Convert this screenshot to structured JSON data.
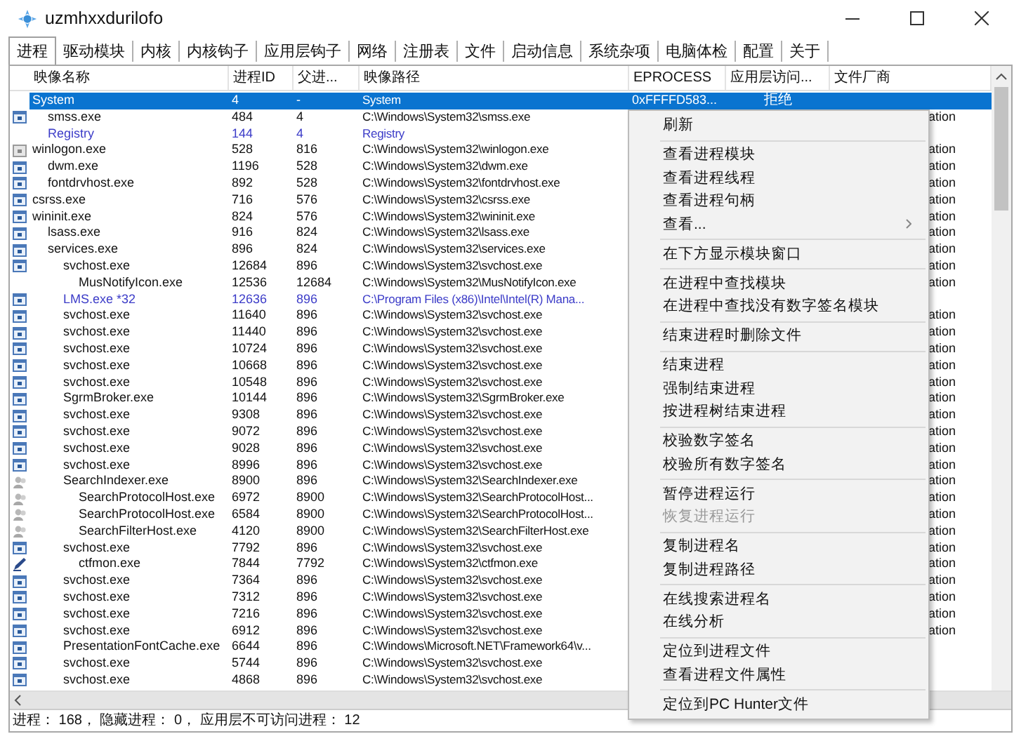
{
  "window": {
    "title": "uzmhxxdurilofo"
  },
  "tabs": [
    {
      "label": "进程",
      "selected": true
    },
    {
      "label": "驱动模块",
      "selected": false
    },
    {
      "label": "内核",
      "selected": false
    },
    {
      "label": "内核钩子",
      "selected": false
    },
    {
      "label": "应用层钩子",
      "selected": false
    },
    {
      "label": "网络",
      "selected": false
    },
    {
      "label": "注册表",
      "selected": false
    },
    {
      "label": "文件",
      "selected": false
    },
    {
      "label": "启动信息",
      "selected": false
    },
    {
      "label": "系统杂项",
      "selected": false
    },
    {
      "label": "电脑体检",
      "selected": false
    },
    {
      "label": "配置",
      "selected": false
    },
    {
      "label": "关于",
      "selected": false
    }
  ],
  "table": {
    "columns": [
      "映像名称",
      "进程ID",
      "父进...",
      "映像路径",
      "EPROCESS",
      "应用层访问...",
      "文件厂商"
    ],
    "rows": [
      {
        "kind": "none",
        "name": "System",
        "pid": "4",
        "parent": "-",
        "path": "System",
        "eprocess": "0xFFFFD583...",
        "access": "拒绝",
        "selected": true,
        "children": [
          {
            "kind": "window",
            "name": "smss.exe",
            "pid": "484",
            "parent": "4",
            "path": "C:\\Windows\\System32\\smss.exe",
            "vendor": "ation",
            "selected": false
          },
          {
            "kind": "none",
            "name": "Registry",
            "pid": "144",
            "parent": "4",
            "path": "Registry",
            "color": "#3c3cc8",
            "selected": false
          }
        ]
      },
      {
        "kind": "gray",
        "name": "winlogon.exe",
        "pid": "528",
        "parent": "816",
        "path": "C:\\Windows\\System32\\winlogon.exe",
        "vendor": "ation",
        "selected": false,
        "children": [
          {
            "kind": "window",
            "name": "dwm.exe",
            "pid": "1196",
            "parent": "528",
            "path": "C:\\Windows\\System32\\dwm.exe",
            "vendor": "ation",
            "selected": false
          },
          {
            "kind": "window",
            "name": "fontdrvhost.exe",
            "pid": "892",
            "parent": "528",
            "path": "C:\\Windows\\System32\\fontdrvhost.exe",
            "vendor": "ation",
            "selected": false
          }
        ]
      },
      {
        "kind": "window",
        "name": "csrss.exe",
        "pid": "716",
        "parent": "576",
        "path": "C:\\Windows\\System32\\csrss.exe",
        "vendor": "ation",
        "selected": false
      },
      {
        "kind": "window",
        "name": "wininit.exe",
        "pid": "824",
        "parent": "576",
        "path": "C:\\Windows\\System32\\wininit.exe",
        "vendor": "ation",
        "selected": false,
        "children": [
          {
            "kind": "window",
            "name": "lsass.exe",
            "pid": "916",
            "parent": "824",
            "path": "C:\\Windows\\System32\\lsass.exe",
            "vendor": "ation",
            "selected": false
          },
          {
            "kind": "window",
            "name": "services.exe",
            "pid": "896",
            "parent": "824",
            "path": "C:\\Windows\\System32\\services.exe",
            "vendor": "ation",
            "selected": false,
            "children": [
              {
                "kind": "window",
                "name": "svchost.exe",
                "pid": "12684",
                "parent": "896",
                "path": "C:\\Windows\\System32\\svchost.exe",
                "vendor": "ation",
                "selected": false,
                "children": [
                  {
                    "kind": "none",
                    "name": "MusNotifyIcon.exe",
                    "pid": "12536",
                    "parent": "12684",
                    "path": "C:\\Windows\\System32\\MusNotifyIcon.exe",
                    "vendor": "ation",
                    "selected": false
                  }
                ]
              },
              {
                "kind": "window",
                "name": "LMS.exe *32",
                "pid": "12636",
                "parent": "896",
                "path": "C:\\Program Files (x86)\\Intel\\Intel(R) Mana...",
                "color": "#3c3cc8",
                "selected": false
              },
              {
                "kind": "window",
                "name": "svchost.exe",
                "pid": "11640",
                "parent": "896",
                "path": "C:\\Windows\\System32\\svchost.exe",
                "vendor": "ation",
                "selected": false
              },
              {
                "kind": "window",
                "name": "svchost.exe",
                "pid": "11440",
                "parent": "896",
                "path": "C:\\Windows\\System32\\svchost.exe",
                "vendor": "ation",
                "selected": false
              },
              {
                "kind": "window",
                "name": "svchost.exe",
                "pid": "10724",
                "parent": "896",
                "path": "C:\\Windows\\System32\\svchost.exe",
                "vendor": "ation",
                "selected": false
              },
              {
                "kind": "window",
                "name": "svchost.exe",
                "pid": "10668",
                "parent": "896",
                "path": "C:\\Windows\\System32\\svchost.exe",
                "vendor": "ation",
                "selected": false
              },
              {
                "kind": "window",
                "name": "svchost.exe",
                "pid": "10548",
                "parent": "896",
                "path": "C:\\Windows\\System32\\svchost.exe",
                "vendor": "ation",
                "selected": false
              },
              {
                "kind": "window",
                "name": "SgrmBroker.exe",
                "pid": "10144",
                "parent": "896",
                "path": "C:\\Windows\\System32\\SgrmBroker.exe",
                "vendor": "ation",
                "selected": false
              },
              {
                "kind": "window",
                "name": "svchost.exe",
                "pid": "9308",
                "parent": "896",
                "path": "C:\\Windows\\System32\\svchost.exe",
                "vendor": "ation",
                "selected": false
              },
              {
                "kind": "window",
                "name": "svchost.exe",
                "pid": "9072",
                "parent": "896",
                "path": "C:\\Windows\\System32\\svchost.exe",
                "vendor": "ation",
                "selected": false
              },
              {
                "kind": "window",
                "name": "svchost.exe",
                "pid": "9028",
                "parent": "896",
                "path": "C:\\Windows\\System32\\svchost.exe",
                "vendor": "ation",
                "selected": false
              },
              {
                "kind": "window",
                "name": "svchost.exe",
                "pid": "8996",
                "parent": "896",
                "path": "C:\\Windows\\System32\\svchost.exe",
                "vendor": "ation",
                "selected": false
              },
              {
                "kind": "search",
                "name": "SearchIndexer.exe",
                "pid": "8900",
                "parent": "896",
                "path": "C:\\Windows\\System32\\SearchIndexer.exe",
                "vendor": "ation",
                "selected": false,
                "children": [
                  {
                    "kind": "search",
                    "name": "SearchProtocolHost.exe",
                    "pid": "6972",
                    "parent": "8900",
                    "path": "C:\\Windows\\System32\\SearchProtocolHost...",
                    "vendor": "ation",
                    "selected": false
                  },
                  {
                    "kind": "search",
                    "name": "SearchProtocolHost.exe",
                    "pid": "6584",
                    "parent": "8900",
                    "path": "C:\\Windows\\System32\\SearchProtocolHost...",
                    "vendor": "ation",
                    "selected": false
                  },
                  {
                    "kind": "search",
                    "name": "SearchFilterHost.exe",
                    "pid": "4120",
                    "parent": "8900",
                    "path": "C:\\Windows\\System32\\SearchFilterHost.exe",
                    "vendor": "ation",
                    "selected": false
                  }
                ]
              },
              {
                "kind": "window",
                "name": "svchost.exe",
                "pid": "7792",
                "parent": "896",
                "path": "C:\\Windows\\System32\\svchost.exe",
                "vendor": "ation",
                "selected": false,
                "children": [
                  {
                    "kind": "pen",
                    "name": "ctfmon.exe",
                    "pid": "7844",
                    "parent": "7792",
                    "path": "C:\\Windows\\System32\\ctfmon.exe",
                    "vendor": "ation",
                    "selected": false
                  }
                ]
              },
              {
                "kind": "window",
                "name": "svchost.exe",
                "pid": "7364",
                "parent": "896",
                "path": "C:\\Windows\\System32\\svchost.exe",
                "vendor": "ation",
                "selected": false
              },
              {
                "kind": "window",
                "name": "svchost.exe",
                "pid": "7312",
                "parent": "896",
                "path": "C:\\Windows\\System32\\svchost.exe",
                "vendor": "ation",
                "selected": false
              },
              {
                "kind": "window",
                "name": "svchost.exe",
                "pid": "7216",
                "parent": "896",
                "path": "C:\\Windows\\System32\\svchost.exe",
                "vendor": "ation",
                "selected": false
              },
              {
                "kind": "window",
                "name": "svchost.exe",
                "pid": "6912",
                "parent": "896",
                "path": "C:\\Windows\\System32\\svchost.exe",
                "vendor": "ation",
                "selected": false
              },
              {
                "kind": "window",
                "name": "PresentationFontCache.exe",
                "pid": "6644",
                "parent": "896",
                "path": "C:\\Windows\\Microsoft.NET\\Framework64\\v...",
                "selected": false
              },
              {
                "kind": "window",
                "name": "svchost.exe",
                "pid": "5744",
                "parent": "896",
                "path": "C:\\Windows\\System32\\svchost.exe",
                "selected": false
              },
              {
                "kind": "window",
                "name": "svchost.exe",
                "pid": "4868",
                "parent": "896",
                "path": "C:\\Windows\\System32\\svchost.exe",
                "selected": false
              }
            ]
          }
        ]
      }
    ]
  },
  "context_menu": {
    "groups": [
      [
        {
          "label": "刷新",
          "disabled": false,
          "submenu": false
        }
      ],
      [
        {
          "label": "查看进程模块",
          "disabled": false,
          "submenu": false
        },
        {
          "label": "查看进程线程",
          "disabled": false,
          "submenu": false
        },
        {
          "label": "查看进程句柄",
          "disabled": false,
          "submenu": false
        },
        {
          "label": "查看...",
          "disabled": false,
          "submenu": true
        }
      ],
      [
        {
          "label": "在下方显示模块窗口",
          "disabled": false,
          "submenu": false
        }
      ],
      [
        {
          "label": "在进程中查找模块",
          "disabled": false,
          "submenu": false
        },
        {
          "label": "在进程中查找没有数字签名模块",
          "disabled": false,
          "submenu": false
        }
      ],
      [
        {
          "label": "结束进程时删除文件",
          "disabled": false,
          "submenu": false
        }
      ],
      [
        {
          "label": "结束进程",
          "disabled": false,
          "submenu": false
        },
        {
          "label": "强制结束进程",
          "disabled": false,
          "submenu": false
        },
        {
          "label": "按进程树结束进程",
          "disabled": false,
          "submenu": false
        }
      ],
      [
        {
          "label": "校验数字签名",
          "disabled": false,
          "submenu": false
        },
        {
          "label": "校验所有数字签名",
          "disabled": false,
          "submenu": false
        }
      ],
      [
        {
          "label": "暂停进程运行",
          "disabled": false,
          "submenu": false
        },
        {
          "label": "恢复进程运行",
          "disabled": true,
          "submenu": false
        }
      ],
      [
        {
          "label": "复制进程名",
          "disabled": false,
          "submenu": false
        },
        {
          "label": "复制进程路径",
          "disabled": false,
          "submenu": false
        }
      ],
      [
        {
          "label": "在线搜索进程名",
          "disabled": false,
          "submenu": false
        },
        {
          "label": "在线分析",
          "disabled": false,
          "submenu": false
        }
      ],
      [
        {
          "label": "定位到进程文件",
          "disabled": false,
          "submenu": false
        },
        {
          "label": "查看进程文件属性",
          "disabled": false,
          "submenu": false
        }
      ],
      [
        {
          "label": "定位到PC Hunter文件",
          "disabled": false,
          "submenu": false
        }
      ]
    ]
  },
  "status_bar": "进程： 168， 隐藏进程： 0， 应用层不可访问进程： 12"
}
